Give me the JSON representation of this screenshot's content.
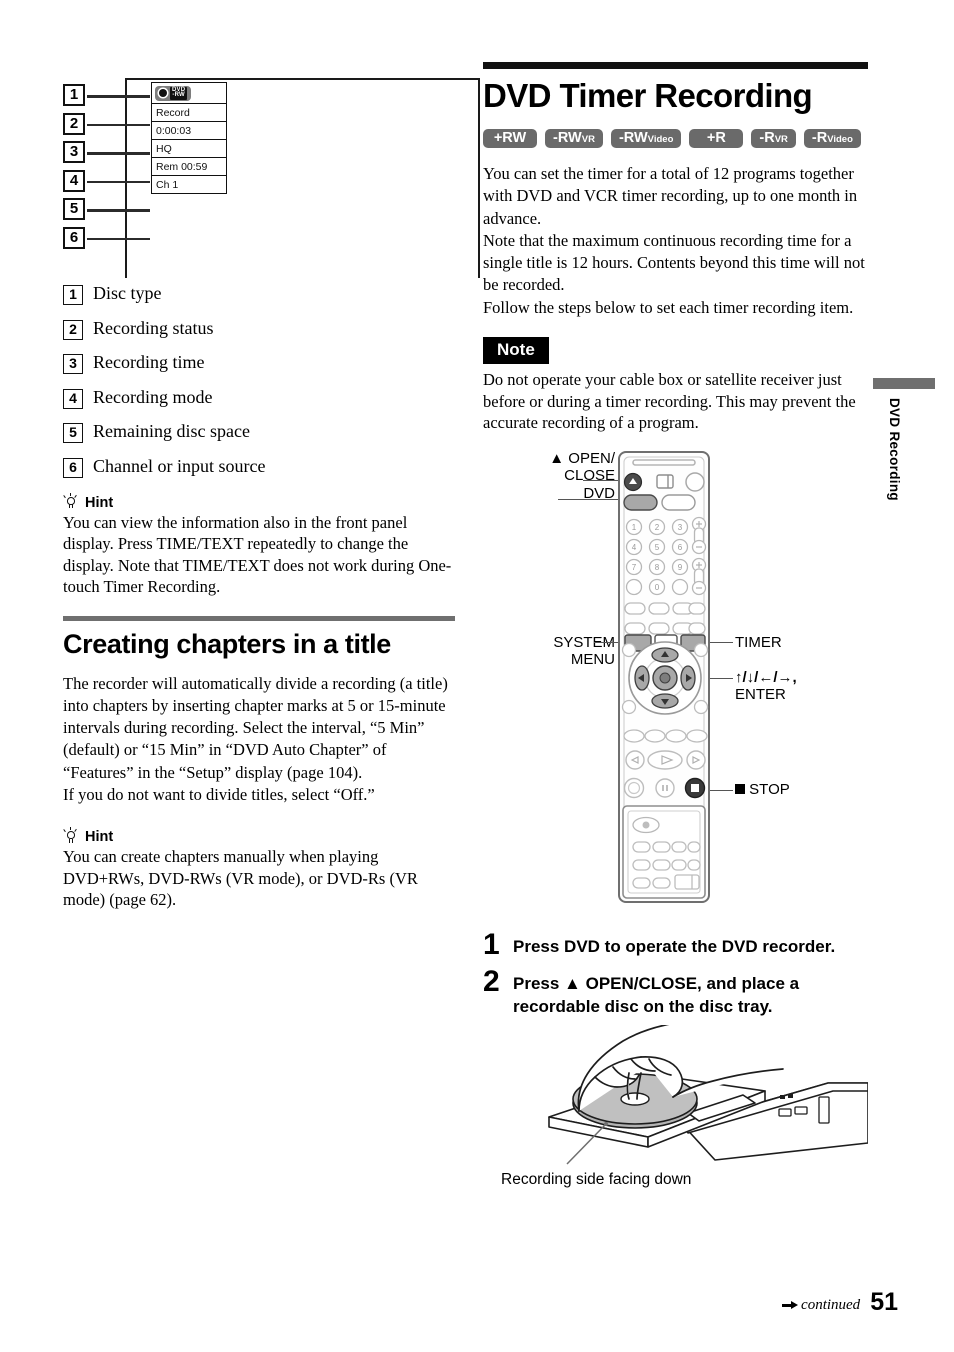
{
  "page": {
    "number": "51",
    "continued": "continued",
    "side_tab": "DVD Recording"
  },
  "left": {
    "display_figure": {
      "callouts": [
        "1",
        "2",
        "3",
        "4",
        "5",
        "6"
      ],
      "panel_rows": [
        {
          "type": "disc-icon",
          "icon": "dvd-rw-record-icon",
          "line1": "DVD",
          "line2": "-RW"
        },
        {
          "type": "text",
          "value": "Record"
        },
        {
          "type": "text",
          "value": "0:00:03"
        },
        {
          "type": "text",
          "value": "HQ"
        },
        {
          "type": "text",
          "value": "Rem 00:59"
        },
        {
          "type": "text",
          "value": "Ch 1"
        }
      ]
    },
    "legend": [
      {
        "n": "1",
        "label": "Disc type"
      },
      {
        "n": "2",
        "label": "Recording status"
      },
      {
        "n": "3",
        "label": "Recording time"
      },
      {
        "n": "4",
        "label": "Recording mode"
      },
      {
        "n": "5",
        "label": "Remaining disc space"
      },
      {
        "n": "6",
        "label": "Channel or input source"
      }
    ],
    "hint1": {
      "title": "Hint",
      "body": "You can view the information also in the front panel display. Press TIME/TEXT repeatedly to change the display. Note that TIME/TEXT does not work during One-touch Timer Recording."
    },
    "section": {
      "title": "Creating chapters in a title",
      "para1": "The recorder will automatically divide a recording (a title) into chapters by inserting chapter marks at 5 or 15-minute intervals during recording. Select the interval, “5 Min” (default) or “15 Min” in “DVD Auto Chapter” of “Features” in the “Setup” display (page 104).",
      "para2": "If you do not want to divide titles, select “Off.”"
    },
    "hint2": {
      "title": "Hint",
      "body": "You can create chapters manually when playing DVD+RWs, DVD-RWs (VR mode), or DVD-Rs (VR mode) (page 62)."
    }
  },
  "right": {
    "title": "DVD Timer Recording",
    "badges": [
      {
        "main": "+RW",
        "sub": ""
      },
      {
        "main": "-RW",
        "sub": "VR"
      },
      {
        "main": "-RW",
        "sub": "Video"
      },
      {
        "main": "+R",
        "sub": ""
      },
      {
        "main": "-R",
        "sub": "VR"
      },
      {
        "main": "-R",
        "sub": "Video"
      }
    ],
    "intro": [
      "You can set the timer for a total of 12 programs together with DVD and VCR timer recording, up to one month in advance.",
      "Note that the maximum continuous recording time for a single title is 12 hours. Contents beyond this time will not be recorded.",
      "Follow the steps below to set each timer recording item."
    ],
    "note": {
      "tag": "Note",
      "body": "Do not operate your cable box or satellite receiver just before or during a timer recording. This may prevent the accurate recording of a program."
    },
    "remote_labels": {
      "open_close_l1": "▲ OPEN/",
      "open_close_l2": "CLOSE",
      "dvd": "DVD",
      "system": "SYSTEM",
      "menu": "MENU",
      "timer": "TIMER",
      "arrows": "↑/↓/←/→,",
      "enter": "ENTER",
      "stop": "STOP"
    },
    "steps": [
      {
        "n": "1",
        "text": "Press DVD to operate the DVD recorder."
      },
      {
        "n": "2",
        "text": "Press ▲ OPEN/CLOSE, and place a recordable disc on the disc tray."
      }
    ],
    "tray_caption": "Recording side facing down"
  },
  "colors": {
    "badge_gray": "#6a6a6a",
    "rule_gray": "#6f6f6f",
    "ink": "#111111"
  }
}
